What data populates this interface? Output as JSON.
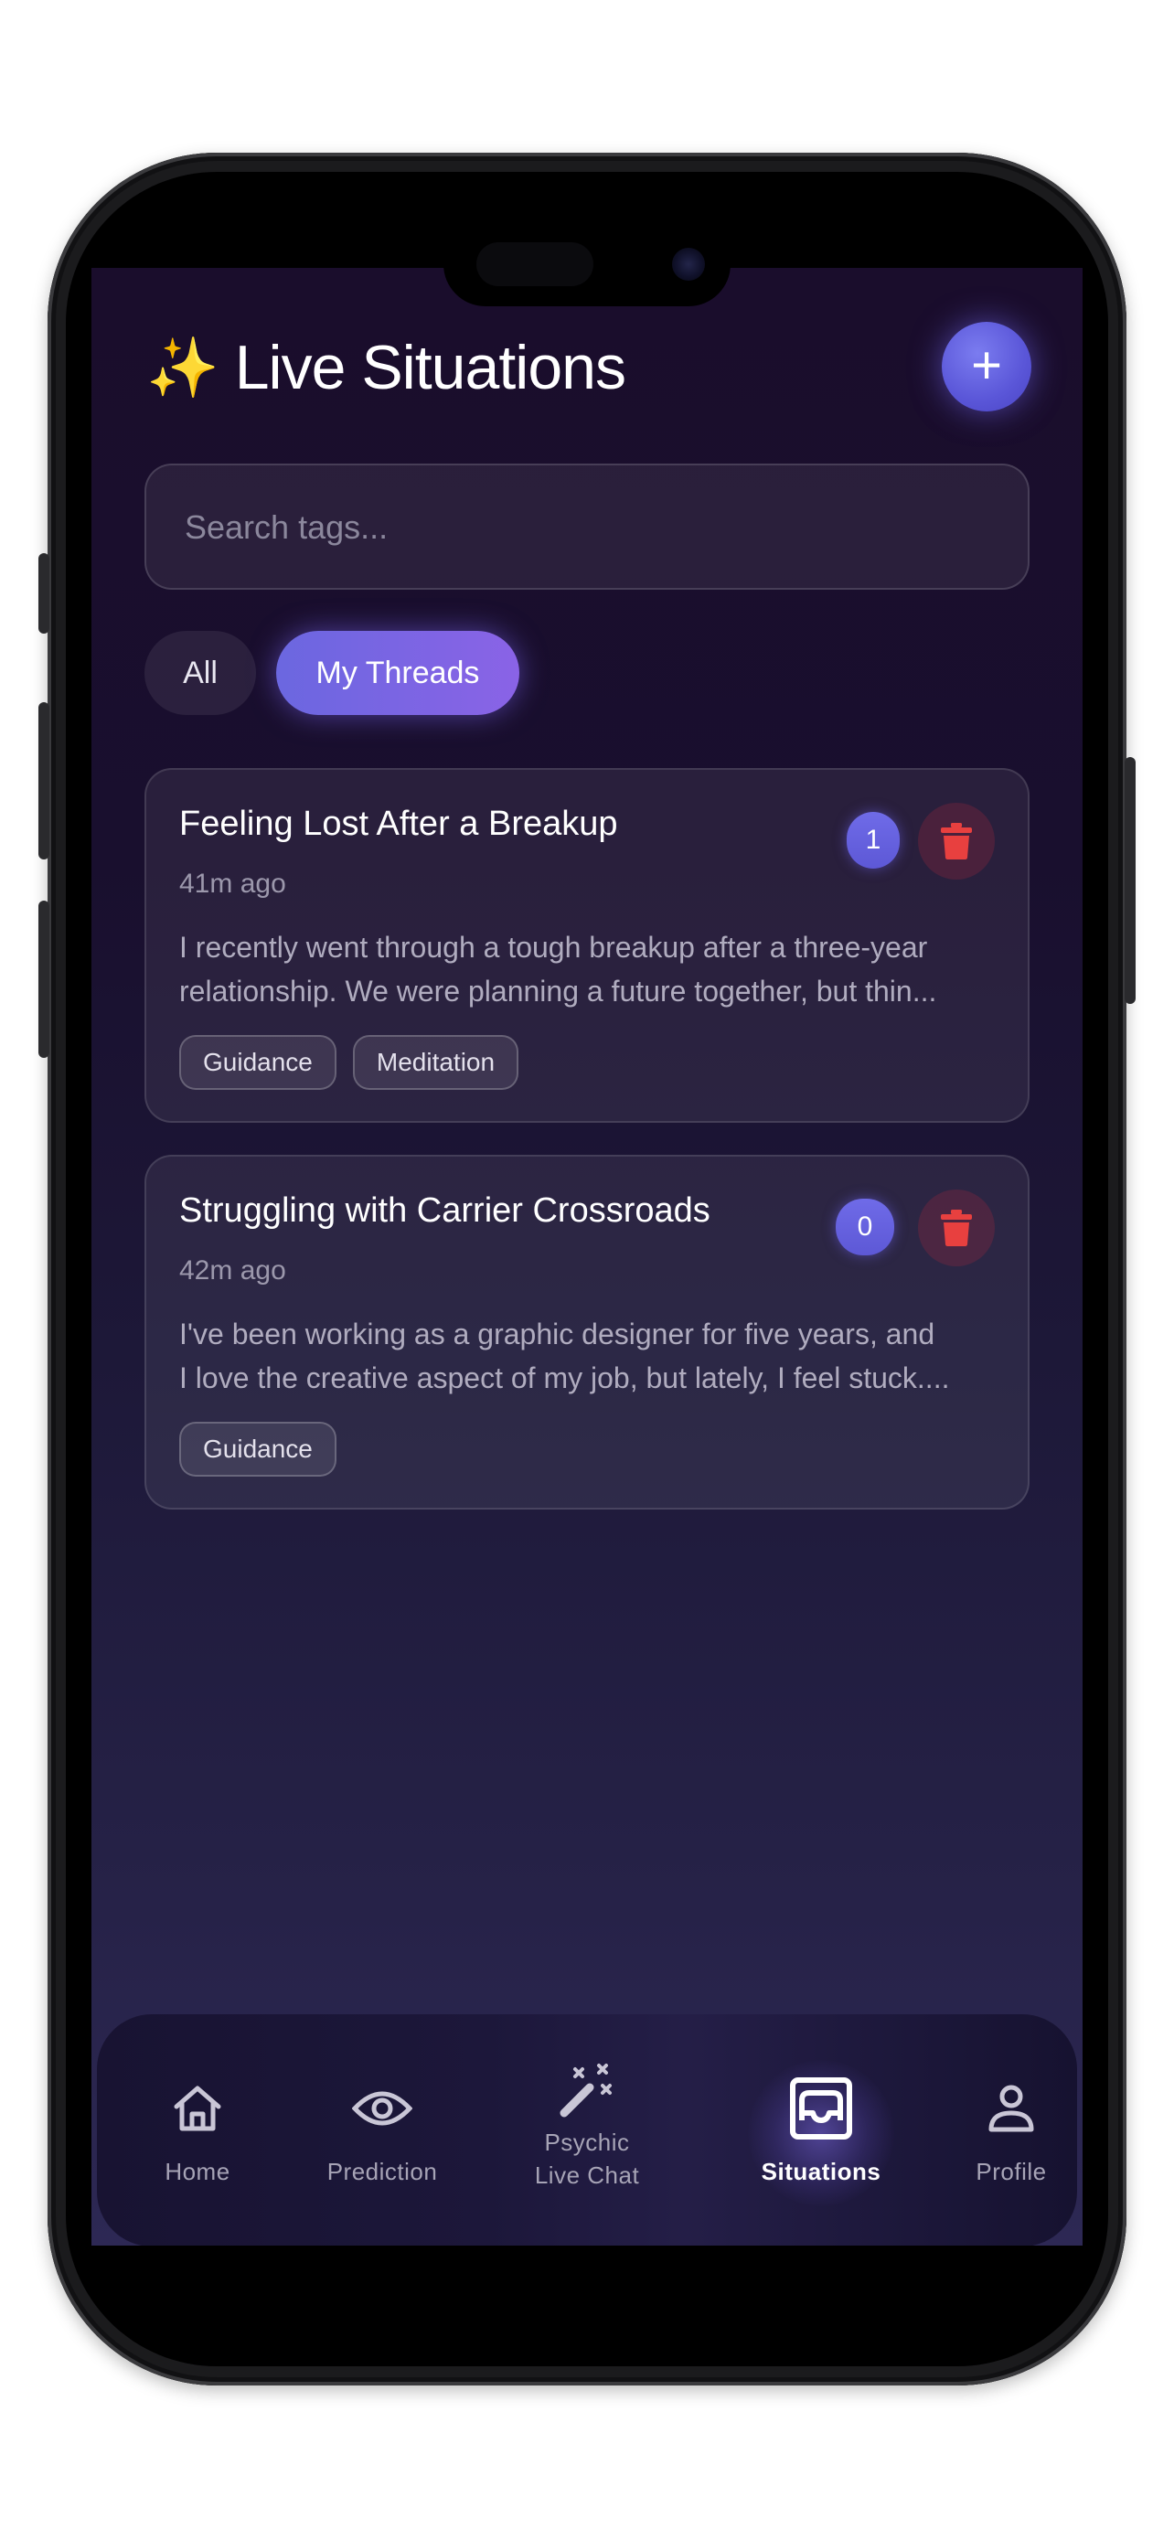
{
  "header": {
    "sparkle": "✨",
    "title": "Live Situations",
    "add_label": "+"
  },
  "search": {
    "placeholder": "Search tags..."
  },
  "filters": {
    "all": "All",
    "mine": "My Threads",
    "active": "mine"
  },
  "threads": [
    {
      "title": "Feeling Lost After a Breakup",
      "time": "41m ago",
      "preview_line1": "I recently went through a tough breakup after a three-year",
      "preview_line2": "relationship. We were planning a future together, but thin...",
      "count": "1",
      "tags": [
        "Guidance",
        "Meditation"
      ]
    },
    {
      "title": "Struggling with Carrier Crossroads",
      "time": "42m ago",
      "preview_line1": "I've been working as a graphic designer for five years, and",
      "preview_line2": "I love the creative aspect of my job, but lately, I feel stuck....",
      "count": "0",
      "tags": [
        "Guidance"
      ]
    }
  ],
  "tabbar": {
    "home": "Home",
    "prediction": "Prediction",
    "psychic_line1": "Psychic",
    "psychic_line2": "Live Chat",
    "situations": "Situations",
    "profile": "Profile",
    "active": "situations"
  },
  "colors": {
    "accent": "#6b67e0",
    "delete": "#e23a3a",
    "background_top": "#1a0d2c",
    "background_bottom": "#2d2854"
  },
  "icons": {
    "home": "home-icon",
    "prediction": "eye-icon",
    "psychic": "magic-wand-icon",
    "situations": "inbox-tray-icon",
    "profile": "user-icon",
    "delete": "trash-icon"
  }
}
